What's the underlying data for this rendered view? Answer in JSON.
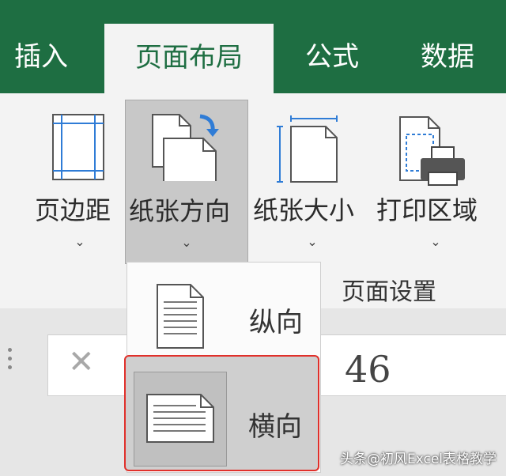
{
  "tabs": [
    {
      "label": "插入"
    },
    {
      "label": "页面布局",
      "active": true
    },
    {
      "label": "公式"
    },
    {
      "label": "数据"
    }
  ],
  "ribbon": {
    "buttons": [
      {
        "label": "页边距",
        "icon": "margins-icon"
      },
      {
        "label": "纸张方向",
        "icon": "orientation-icon",
        "pressed": true
      },
      {
        "label": "纸张大小",
        "icon": "paper-size-icon"
      },
      {
        "label": "打印区域",
        "icon": "print-area-icon"
      }
    ],
    "group_label": "页面设置",
    "dropdown_chevron": "⌄"
  },
  "orientation_menu": {
    "items": [
      {
        "label": "纵向",
        "icon": "portrait-page-icon"
      },
      {
        "label": "横向",
        "icon": "landscape-page-icon",
        "selected": true
      }
    ]
  },
  "formula_bar": {
    "cancel_symbol": "✕",
    "value": "46"
  },
  "watermark": "头条@初风Excel表格教学",
  "colors": {
    "ribbon_tab_bg": "#1e6e42",
    "active_tab_text": "#1e6e42",
    "highlight_border": "#e0302a",
    "icon_blue": "#2f7cd6"
  }
}
